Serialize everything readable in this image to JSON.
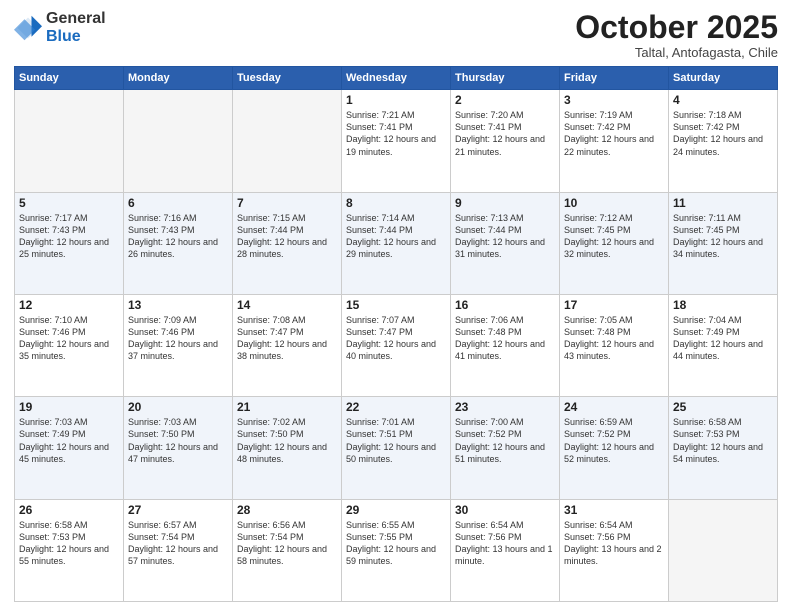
{
  "logo": {
    "general": "General",
    "blue": "Blue"
  },
  "title": "October 2025",
  "subtitle": "Taltal, Antofagasta, Chile",
  "days_header": [
    "Sunday",
    "Monday",
    "Tuesday",
    "Wednesday",
    "Thursday",
    "Friday",
    "Saturday"
  ],
  "weeks": [
    [
      {
        "day": "",
        "sunrise": "",
        "sunset": "",
        "daylight": ""
      },
      {
        "day": "",
        "sunrise": "",
        "sunset": "",
        "daylight": ""
      },
      {
        "day": "",
        "sunrise": "",
        "sunset": "",
        "daylight": ""
      },
      {
        "day": "1",
        "sunrise": "Sunrise: 7:21 AM",
        "sunset": "Sunset: 7:41 PM",
        "daylight": "Daylight: 12 hours and 19 minutes."
      },
      {
        "day": "2",
        "sunrise": "Sunrise: 7:20 AM",
        "sunset": "Sunset: 7:41 PM",
        "daylight": "Daylight: 12 hours and 21 minutes."
      },
      {
        "day": "3",
        "sunrise": "Sunrise: 7:19 AM",
        "sunset": "Sunset: 7:42 PM",
        "daylight": "Daylight: 12 hours and 22 minutes."
      },
      {
        "day": "4",
        "sunrise": "Sunrise: 7:18 AM",
        "sunset": "Sunset: 7:42 PM",
        "daylight": "Daylight: 12 hours and 24 minutes."
      }
    ],
    [
      {
        "day": "5",
        "sunrise": "Sunrise: 7:17 AM",
        "sunset": "Sunset: 7:43 PM",
        "daylight": "Daylight: 12 hours and 25 minutes."
      },
      {
        "day": "6",
        "sunrise": "Sunrise: 7:16 AM",
        "sunset": "Sunset: 7:43 PM",
        "daylight": "Daylight: 12 hours and 26 minutes."
      },
      {
        "day": "7",
        "sunrise": "Sunrise: 7:15 AM",
        "sunset": "Sunset: 7:44 PM",
        "daylight": "Daylight: 12 hours and 28 minutes."
      },
      {
        "day": "8",
        "sunrise": "Sunrise: 7:14 AM",
        "sunset": "Sunset: 7:44 PM",
        "daylight": "Daylight: 12 hours and 29 minutes."
      },
      {
        "day": "9",
        "sunrise": "Sunrise: 7:13 AM",
        "sunset": "Sunset: 7:44 PM",
        "daylight": "Daylight: 12 hours and 31 minutes."
      },
      {
        "day": "10",
        "sunrise": "Sunrise: 7:12 AM",
        "sunset": "Sunset: 7:45 PM",
        "daylight": "Daylight: 12 hours and 32 minutes."
      },
      {
        "day": "11",
        "sunrise": "Sunrise: 7:11 AM",
        "sunset": "Sunset: 7:45 PM",
        "daylight": "Daylight: 12 hours and 34 minutes."
      }
    ],
    [
      {
        "day": "12",
        "sunrise": "Sunrise: 7:10 AM",
        "sunset": "Sunset: 7:46 PM",
        "daylight": "Daylight: 12 hours and 35 minutes."
      },
      {
        "day": "13",
        "sunrise": "Sunrise: 7:09 AM",
        "sunset": "Sunset: 7:46 PM",
        "daylight": "Daylight: 12 hours and 37 minutes."
      },
      {
        "day": "14",
        "sunrise": "Sunrise: 7:08 AM",
        "sunset": "Sunset: 7:47 PM",
        "daylight": "Daylight: 12 hours and 38 minutes."
      },
      {
        "day": "15",
        "sunrise": "Sunrise: 7:07 AM",
        "sunset": "Sunset: 7:47 PM",
        "daylight": "Daylight: 12 hours and 40 minutes."
      },
      {
        "day": "16",
        "sunrise": "Sunrise: 7:06 AM",
        "sunset": "Sunset: 7:48 PM",
        "daylight": "Daylight: 12 hours and 41 minutes."
      },
      {
        "day": "17",
        "sunrise": "Sunrise: 7:05 AM",
        "sunset": "Sunset: 7:48 PM",
        "daylight": "Daylight: 12 hours and 43 minutes."
      },
      {
        "day": "18",
        "sunrise": "Sunrise: 7:04 AM",
        "sunset": "Sunset: 7:49 PM",
        "daylight": "Daylight: 12 hours and 44 minutes."
      }
    ],
    [
      {
        "day": "19",
        "sunrise": "Sunrise: 7:03 AM",
        "sunset": "Sunset: 7:49 PM",
        "daylight": "Daylight: 12 hours and 45 minutes."
      },
      {
        "day": "20",
        "sunrise": "Sunrise: 7:03 AM",
        "sunset": "Sunset: 7:50 PM",
        "daylight": "Daylight: 12 hours and 47 minutes."
      },
      {
        "day": "21",
        "sunrise": "Sunrise: 7:02 AM",
        "sunset": "Sunset: 7:50 PM",
        "daylight": "Daylight: 12 hours and 48 minutes."
      },
      {
        "day": "22",
        "sunrise": "Sunrise: 7:01 AM",
        "sunset": "Sunset: 7:51 PM",
        "daylight": "Daylight: 12 hours and 50 minutes."
      },
      {
        "day": "23",
        "sunrise": "Sunrise: 7:00 AM",
        "sunset": "Sunset: 7:52 PM",
        "daylight": "Daylight: 12 hours and 51 minutes."
      },
      {
        "day": "24",
        "sunrise": "Sunrise: 6:59 AM",
        "sunset": "Sunset: 7:52 PM",
        "daylight": "Daylight: 12 hours and 52 minutes."
      },
      {
        "day": "25",
        "sunrise": "Sunrise: 6:58 AM",
        "sunset": "Sunset: 7:53 PM",
        "daylight": "Daylight: 12 hours and 54 minutes."
      }
    ],
    [
      {
        "day": "26",
        "sunrise": "Sunrise: 6:58 AM",
        "sunset": "Sunset: 7:53 PM",
        "daylight": "Daylight: 12 hours and 55 minutes."
      },
      {
        "day": "27",
        "sunrise": "Sunrise: 6:57 AM",
        "sunset": "Sunset: 7:54 PM",
        "daylight": "Daylight: 12 hours and 57 minutes."
      },
      {
        "day": "28",
        "sunrise": "Sunrise: 6:56 AM",
        "sunset": "Sunset: 7:54 PM",
        "daylight": "Daylight: 12 hours and 58 minutes."
      },
      {
        "day": "29",
        "sunrise": "Sunrise: 6:55 AM",
        "sunset": "Sunset: 7:55 PM",
        "daylight": "Daylight: 12 hours and 59 minutes."
      },
      {
        "day": "30",
        "sunrise": "Sunrise: 6:54 AM",
        "sunset": "Sunset: 7:56 PM",
        "daylight": "Daylight: 13 hours and 1 minute."
      },
      {
        "day": "31",
        "sunrise": "Sunrise: 6:54 AM",
        "sunset": "Sunset: 7:56 PM",
        "daylight": "Daylight: 13 hours and 2 minutes."
      },
      {
        "day": "",
        "sunrise": "",
        "sunset": "",
        "daylight": ""
      }
    ]
  ]
}
